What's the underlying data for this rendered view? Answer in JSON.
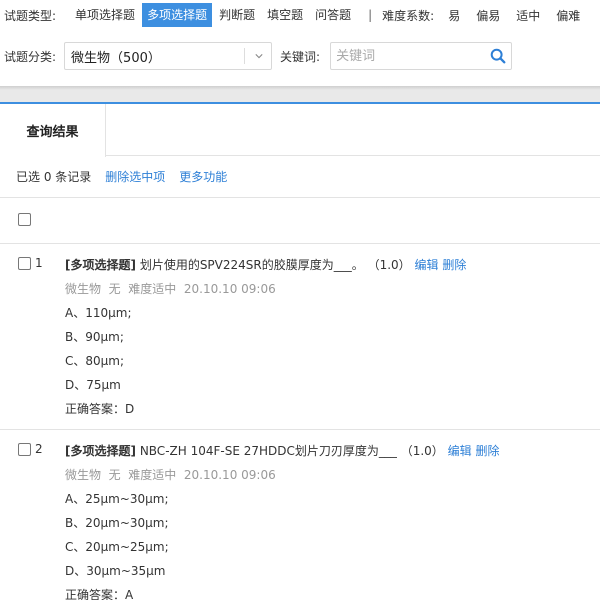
{
  "filter": {
    "type_label": "试题类型:",
    "types": [
      "单项选择题",
      "多项选择题",
      "判断题",
      "填空题",
      "问答题"
    ],
    "active_type": "多项选择题",
    "separator": "|",
    "difficulty_label": "难度系数:",
    "difficulties": [
      "易",
      "偏易",
      "适中",
      "偏难"
    ],
    "category_label": "试题分类:",
    "category_value": "微生物（500）",
    "keyword_label": "关键词:",
    "keyword_placeholder": "关键词",
    "keyword_value": ""
  },
  "results": {
    "tab_label": "查询结果",
    "selected_text": "已选 0 条记录",
    "delete_selected": "删除选中项",
    "more_functions": "更多功能"
  },
  "questions": [
    {
      "index": "1",
      "type_tag": "[多项选择题]",
      "text": "划片使用的SPV224SR的胶膜厚度为___。",
      "score": "（1.0）",
      "edit": "编辑",
      "delete": "删除",
      "meta": "微生物  无  难度适中  20.10.10 09:06",
      "options": [
        "A、110μm;",
        "B、90μm;",
        "C、80μm;",
        "D、75μm"
      ],
      "answer": "正确答案：D"
    },
    {
      "index": "2",
      "type_tag": "[多项选择题]",
      "text": "NBC-ZH 104F-SE 27HDDC划片刀刃厚度为___",
      "score": "（1.0）",
      "edit": "编辑",
      "delete": "删除",
      "meta": "微生物  无  难度适中  20.10.10 09:06",
      "options": [
        "A、25μm~30μm;",
        "B、20μm~30μm;",
        "C、20μm~25μm;",
        "D、30μm~35μm"
      ],
      "answer": "正确答案：A"
    }
  ],
  "colors": {
    "accent": "#3d8fe0",
    "link": "#2d7fd6",
    "meta": "#999999",
    "gap": "#e9e9e9"
  },
  "icons": {
    "search": "search-icon",
    "dropdown": "chevron-down-icon"
  }
}
